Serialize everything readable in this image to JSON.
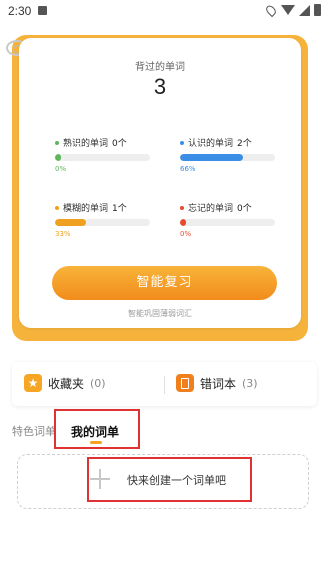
{
  "status_bar": {
    "time": "2:30"
  },
  "stats": {
    "title": "背过的单词",
    "total": "3",
    "items": [
      {
        "label": "熟识的单词",
        "count": "0个",
        "percent": "0%",
        "fraction": 0,
        "color": "#5cb85c"
      },
      {
        "label": "认识的单词",
        "count": "2个",
        "percent": "66%",
        "fraction": 0.66,
        "color": "#3a8ee6"
      },
      {
        "label": "模糊的单词",
        "count": "1个",
        "percent": "33%",
        "fraction": 0.33,
        "color": "#f0a020"
      },
      {
        "label": "忘记的单词",
        "count": "0个",
        "percent": "0%",
        "fraction": 0,
        "color": "#e84a2f"
      }
    ],
    "review_button": "智能复习",
    "review_sub": "智能巩固薄弱词汇"
  },
  "collection": {
    "favorites_label": "收藏夹",
    "favorites_count": "(0)",
    "mistakes_label": "错词本",
    "mistakes_count": "(3)"
  },
  "tabs": {
    "special": "特色词单",
    "mine": "我的词单"
  },
  "create": {
    "label": "快来创建一个词单吧"
  },
  "colors": {
    "accent": "#f6b33c",
    "highlight": "#e03232"
  }
}
